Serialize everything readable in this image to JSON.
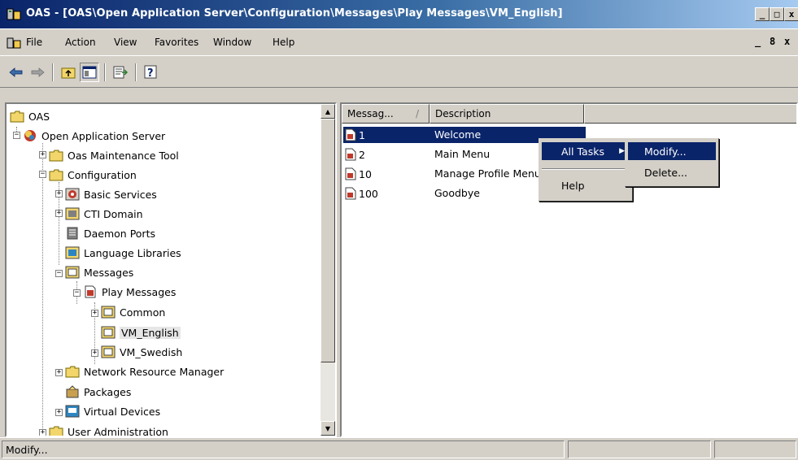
{
  "window": {
    "title": "OAS - [OAS\\Open Application Server\\Configuration\\Messages\\Play Messages\\VM_English]",
    "caption_buttons": [
      "_",
      "□",
      "x"
    ],
    "mdi_buttons": [
      "_",
      "8",
      "x"
    ]
  },
  "menubar": {
    "items": [
      "File",
      "Action",
      "View",
      "Favorites",
      "Window",
      "Help"
    ]
  },
  "toolbar": {
    "buttons": [
      "back-icon",
      "forward-icon",
      "up-folder-icon",
      "show-hide-tree-icon",
      "export-list-icon",
      "help-icon"
    ]
  },
  "tree": {
    "root": "OAS",
    "server": "Open Application Server",
    "maintenance": "Oas Maintenance Tool",
    "configuration": "Configuration",
    "basic_services": "Basic Services",
    "cti_domain": "CTI Domain",
    "daemon_ports": "Daemon Ports",
    "language_libraries": "Language Libraries",
    "messages": "Messages",
    "play_messages": "Play Messages",
    "common": "Common",
    "vm_english": "VM_English",
    "vm_swedish": "VM_Swedish",
    "network_resource_manager": "Network Resource Manager",
    "packages": "Packages",
    "virtual_devices": "Virtual Devices",
    "user_administration": "User Administration"
  },
  "list": {
    "columns": [
      "Messag...",
      "Description"
    ],
    "sort_indicator": "/",
    "rows": [
      {
        "id": "1",
        "description": "Welcome"
      },
      {
        "id": "2",
        "description": "Main Menu"
      },
      {
        "id": "10",
        "description": "Manage Profile Menu"
      },
      {
        "id": "100",
        "description": "Goodbye"
      }
    ]
  },
  "context_menu": {
    "all_tasks": "All Tasks",
    "help": "Help"
  },
  "submenu": {
    "modify": "Modify...",
    "delete": "Delete..."
  },
  "statusbar": {
    "text": "Modify..."
  },
  "colors": {
    "title_start": "#0a246a",
    "title_end": "#a6caf0",
    "selection": "#0a246a",
    "face": "#d4d0c8"
  }
}
